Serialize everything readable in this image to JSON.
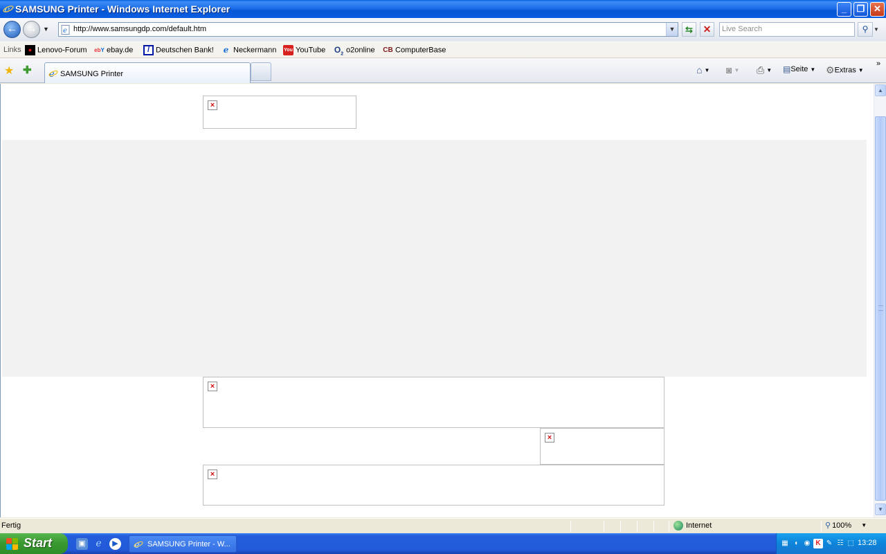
{
  "window": {
    "title": "SAMSUNG Printer - Windows Internet Explorer"
  },
  "address": {
    "url": "http://www.samsungdp.com/default.htm",
    "search_placeholder": "Live Search"
  },
  "links_bar": {
    "label": "Links",
    "items": [
      {
        "label": "Lenovo-Forum",
        "icon": "lenovo-icon"
      },
      {
        "label": "ebay.de",
        "icon": "ebay-icon"
      },
      {
        "label": "Deutschen Bank!",
        "icon": "deutsche-bank-icon"
      },
      {
        "label": "Neckermann",
        "icon": "ie-page-icon"
      },
      {
        "label": "YouTube",
        "icon": "youtube-icon"
      },
      {
        "label": "o2online",
        "icon": "o2-icon"
      },
      {
        "label": "ComputerBase",
        "icon": "computerbase-icon"
      }
    ]
  },
  "tabs": {
    "active_label": "SAMSUNG Printer"
  },
  "toolbar": {
    "page_label": "Seite",
    "tools_label": "Extras"
  },
  "status": {
    "text": "Fertig",
    "zone": "Internet",
    "zoom": "100%"
  },
  "taskbar": {
    "start_label": "Start",
    "task_label": "SAMSUNG Printer - W...",
    "clock": "13:28"
  },
  "colors": {
    "title_blue": "#0A5FDE",
    "start_green": "#3C9A33",
    "taskbar_blue": "#245DDB",
    "band_gray": "#F2F2F2",
    "broken_x": "#D01010"
  }
}
